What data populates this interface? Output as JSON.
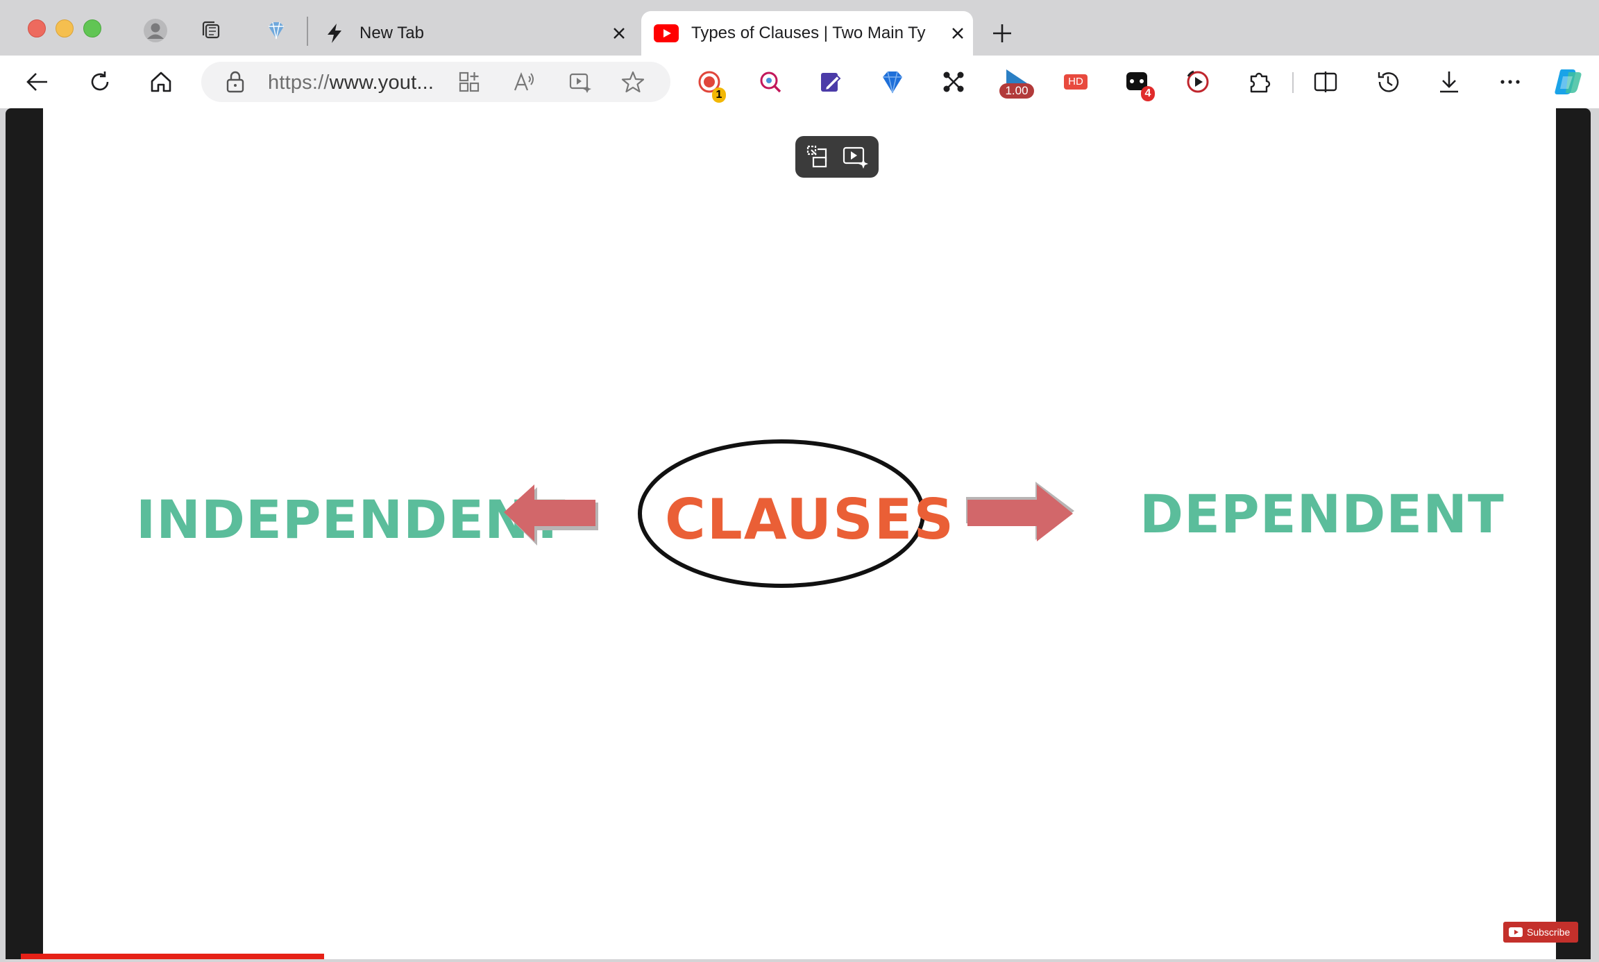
{
  "browser": {
    "tabs": [
      {
        "label": "New Tab",
        "active": false
      },
      {
        "label": "Types of Clauses | Two Main Ty",
        "active": true
      }
    ],
    "address_bar": {
      "scheme": "https://",
      "host_truncated": "www.yout..."
    },
    "extensions": {
      "record_badge": "1",
      "speed_badge": "1.00",
      "hd_label": "HD",
      "notif_badge": "4"
    }
  },
  "video": {
    "center_word": "CLAUSES",
    "left_word": "INDEPENDENT",
    "right_word": "DEPENDENT",
    "subscribe_label": "Subscribe",
    "progress_fraction": 0.195,
    "colors": {
      "green_text": "#5bbd9b",
      "orange_text": "#ea5f36",
      "arrow": "#d2676a",
      "progress": "#e62117"
    }
  }
}
